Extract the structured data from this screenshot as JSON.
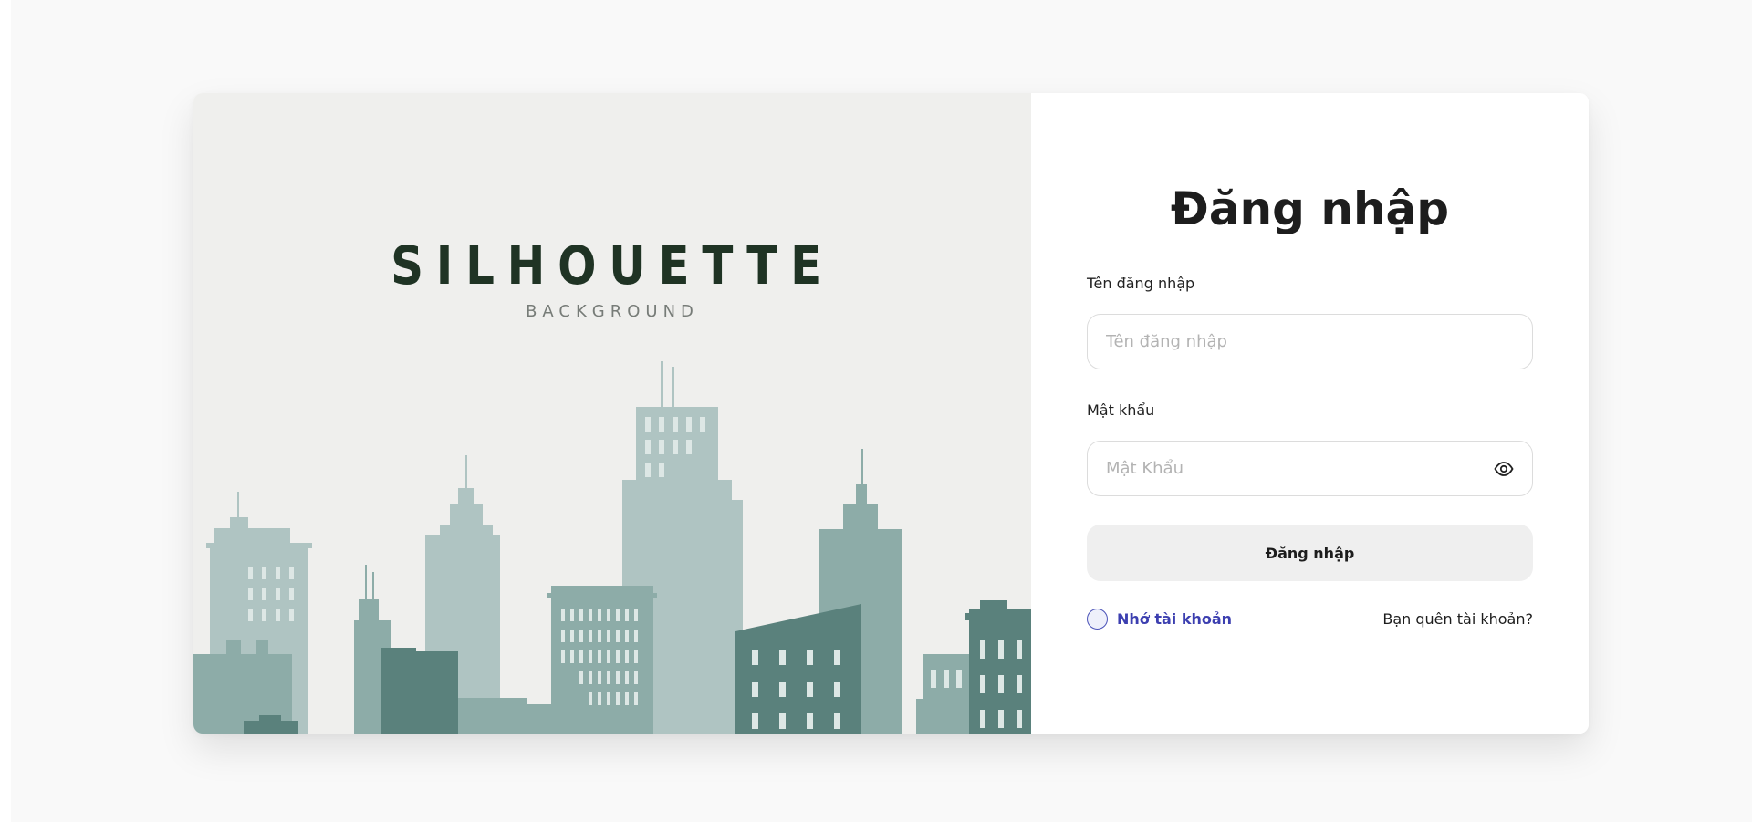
{
  "brand": {
    "title": "SILHOUETTE",
    "subtitle": "BACKGROUND"
  },
  "login": {
    "title": "Đăng nhập",
    "username_label": "Tên đăng nhập",
    "username_placeholder": "Tên đăng nhập",
    "username_value": "",
    "password_label": "Mật khẩu",
    "password_placeholder": "Mật Khẩu",
    "password_value": "",
    "submit_label": "Đăng nhập",
    "remember_label": "Nhớ tài khoản",
    "remember_checked": false,
    "forgot_label": "Bạn quên tài khoản?"
  },
  "icons": {
    "password_toggle": "eye-icon",
    "remember_control": "radio-circle"
  },
  "colors": {
    "page_background": "#f9f9f9",
    "illustration_background": "#efefed",
    "brand_title": "#1f3324",
    "skyline_light": "#afc4c2",
    "skyline_mid": "#8daca8",
    "skyline_dark": "#5a817c",
    "accent_link": "#3c3fb0",
    "button_background": "#efefef"
  }
}
